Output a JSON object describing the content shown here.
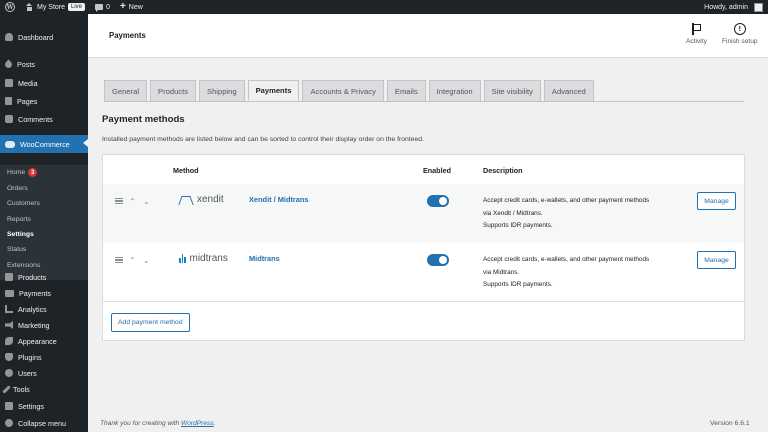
{
  "admin_bar": {
    "site_name": "My Store",
    "live_label": "Live",
    "comments_count": "0",
    "new_label": "New",
    "howdy": "Howdy, admin"
  },
  "sidebar": {
    "items": [
      {
        "label": "Dashboard",
        "icon": "dashboard-icon"
      },
      {
        "label": "Posts",
        "icon": "pin-icon"
      },
      {
        "label": "Media",
        "icon": "media-icon"
      },
      {
        "label": "Pages",
        "icon": "pages-icon"
      },
      {
        "label": "Comments",
        "icon": "comment-icon"
      },
      {
        "label": "WooCommerce",
        "icon": "woo-icon"
      },
      {
        "label": "Products",
        "icon": "box-icon"
      },
      {
        "label": "Payments",
        "icon": "card-icon"
      },
      {
        "label": "Analytics",
        "icon": "chart-icon"
      },
      {
        "label": "Marketing",
        "icon": "megaphone-icon"
      },
      {
        "label": "Appearance",
        "icon": "brush-icon"
      },
      {
        "label": "Plugins",
        "icon": "plug-icon"
      },
      {
        "label": "Users",
        "icon": "user-icon"
      },
      {
        "label": "Tools",
        "icon": "wrench-icon"
      },
      {
        "label": "Settings",
        "icon": "settings-icon"
      },
      {
        "label": "Collapse menu",
        "icon": "collapse-icon"
      }
    ],
    "woo_submenu": [
      {
        "label": "Home",
        "badge": "3"
      },
      {
        "label": "Orders"
      },
      {
        "label": "Customers"
      },
      {
        "label": "Reports"
      },
      {
        "label": "Settings"
      },
      {
        "label": "Status"
      },
      {
        "label": "Extensions"
      }
    ]
  },
  "header": {
    "title": "Payments",
    "activity_label": "Activity",
    "finish_setup_label": "Finish setup"
  },
  "tabs": [
    "General",
    "Products",
    "Shipping",
    "Payments",
    "Accounts & Privacy",
    "Emails",
    "Integration",
    "Site visibility",
    "Advanced"
  ],
  "active_tab": "Payments",
  "section": {
    "title": "Payment methods",
    "description": "Installed payment methods are listed below and can be sorted to control their display order on the fronteed."
  },
  "table": {
    "columns": {
      "method": "Method",
      "enabled": "Enabled",
      "description": "Description"
    },
    "rows": [
      {
        "logo_text": "xendit",
        "name": "Xendit / Midtrans",
        "enabled": true,
        "desc_lines": [
          "Accept credit cards, e-wallets, and other payment methods",
          "via Xendit / Midtrans.",
          "Supports IDR payments."
        ],
        "manage_label": "Manage"
      },
      {
        "logo_text": "midtrans",
        "name": "Midtrans",
        "enabled": true,
        "desc_lines": [
          "Accept credit cards, e-wallets, and other payment methods",
          "via Midtrans.",
          "Supports IDR payments."
        ],
        "manage_label": "Manage"
      }
    ],
    "add_button": "Add payment method"
  },
  "footer": {
    "thanks_prefix": "Thank you for creating with ",
    "wordpress_link": "WordPress",
    "thanks_suffix": ".",
    "version": "Version 6.6.1"
  },
  "colors": {
    "accent": "#2271b1",
    "sidebar_bg": "#1d2327",
    "badge": "#d63638"
  }
}
